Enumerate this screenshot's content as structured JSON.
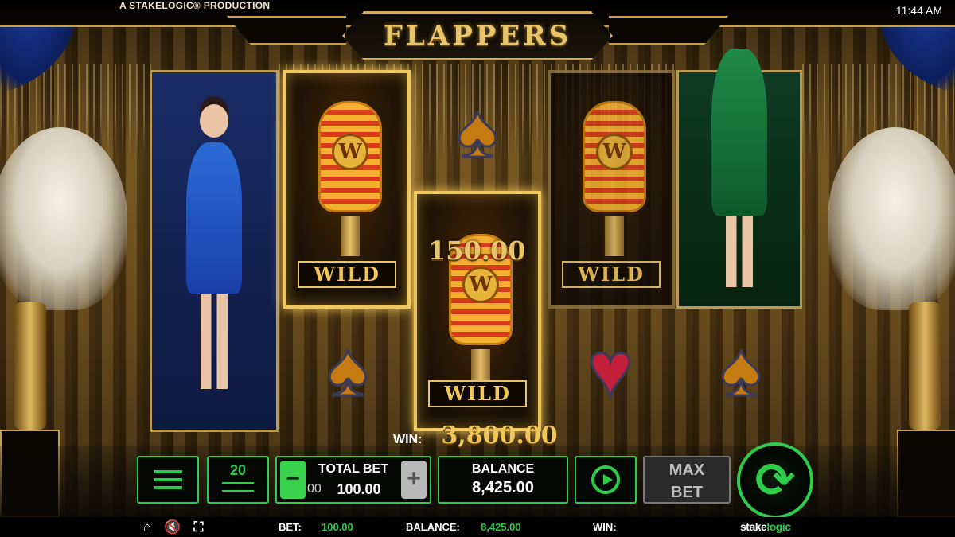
{
  "header": {
    "producer": "A STAKELOGIC® PRODUCTION",
    "game_title": "FLAPPERS",
    "clock": "11:44 AM"
  },
  "reels": {
    "wild_label": "WILD",
    "win_popup": "150.00",
    "symbols": [
      "lady-blue",
      "wild-mic",
      "spade",
      "wild-mic",
      "wild-mic",
      "lady-green",
      "spade",
      "heart",
      "spade"
    ]
  },
  "win_display": {
    "label": "WIN:",
    "amount": "3,800.00"
  },
  "controls": {
    "lines": "20",
    "total_bet_label": "TOTAL BET",
    "total_bet_prev": "00",
    "total_bet_value": "100.00",
    "minus": "−",
    "plus": "+",
    "balance_label": "BALANCE",
    "balance_value": "8,425.00",
    "max_bet_line1": "MAX",
    "max_bet_line2": "BET"
  },
  "status_bar": {
    "bet_label": "BET:",
    "bet_value": "100.00",
    "balance_label": "BALANCE:",
    "balance_value": "8,425.00",
    "win_label": "WIN:",
    "win_value": "",
    "brand_prefix": "stake",
    "brand_suffix": "logic"
  },
  "colors": {
    "accent_green": "#2ecc4a",
    "gold": "#e8c46a"
  }
}
